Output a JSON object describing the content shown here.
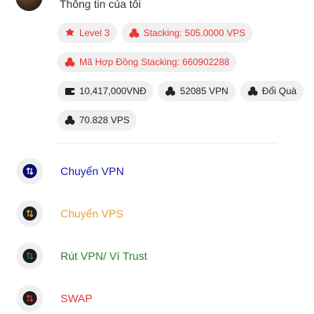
{
  "profile": {
    "title": "Thông tin của tôi"
  },
  "chips": {
    "level": "Level 3",
    "stacking": "Stacking: 505.0000 VPS",
    "contract": "Mã Hợp Đồng Stacking: 660902288",
    "vnd": "10,417,000VNĐ",
    "vpn": "52085 VPN",
    "exchange": "Đổi Quà",
    "vps": "70.828 VPS"
  },
  "menu": {
    "items": [
      {
        "label": "Chuyển VPN",
        "color": "#1a1aa6",
        "icon": "transfer-vpn-icon"
      },
      {
        "label": "Chuyển VPS",
        "color": "#e8a23a",
        "icon": "transfer-vps-icon"
      },
      {
        "label": "Rút VPN/ Ví Trust",
        "color": "#2e7d32",
        "icon": "withdraw-icon"
      },
      {
        "label": "SWAP",
        "color": "#e53935",
        "icon": "swap-icon"
      }
    ]
  },
  "colors": {
    "accent_red": "#e53935",
    "chip_bg": "#f0f0f0",
    "text_dark": "#222222"
  }
}
